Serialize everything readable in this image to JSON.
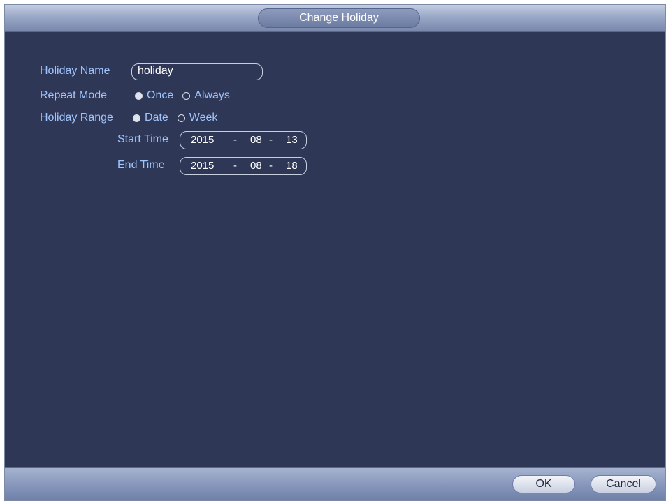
{
  "dialog": {
    "title": "Change Holiday"
  },
  "form": {
    "holiday_name": {
      "label": "Holiday Name",
      "value": "holiday"
    },
    "repeat_mode": {
      "label": "Repeat Mode",
      "options": [
        "Once",
        "Always"
      ],
      "selected": "Once"
    },
    "holiday_range": {
      "label": "Holiday Range",
      "options": [
        "Date",
        "Week"
      ],
      "selected": "Date"
    },
    "start_time": {
      "label": "Start Time",
      "year": "2015",
      "month": "08",
      "day": "13",
      "sep": "-"
    },
    "end_time": {
      "label": "End Time",
      "year": "2015",
      "month": "08",
      "day": "18",
      "sep": "-"
    }
  },
  "buttons": {
    "ok": "OK",
    "cancel": "Cancel"
  },
  "colors": {
    "background": "#2f3756",
    "label": "#9fc5ff",
    "titlebar": "#9aa8c7"
  }
}
